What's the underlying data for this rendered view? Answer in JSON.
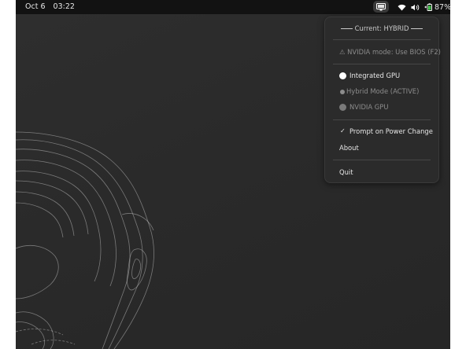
{
  "topbar": {
    "date": "Oct 6",
    "time": "03:22",
    "tray_indicator_icon": "display-gpu-icon",
    "wifi_icon": "wifi-icon",
    "volume_icon": "volume-icon",
    "battery_icon": "battery-charging-icon",
    "battery_level": "87%"
  },
  "menu": {
    "header": "Current: HYBRID",
    "bios_note": "⚠ NVIDIA mode: Use BIOS (F2)",
    "gpu_options": [
      {
        "label": "Integrated GPU",
        "state": "available",
        "color": "#e6e6e6"
      },
      {
        "label": "Hybrid Mode (ACTIVE)",
        "state": "active",
        "color": "#8c8c8c"
      },
      {
        "label": "NVIDIA GPU",
        "state": "disabled",
        "color": "#8c8c8c"
      }
    ],
    "prompt_on_power_change": {
      "label": "Prompt on Power Change",
      "checked": true
    },
    "about": "About",
    "quit": "Quit"
  },
  "colors": {
    "topbar_bg": "#121212",
    "desktop_bg": "#2a2a2a",
    "menu_bg": "#2b2b2b",
    "menu_text": "#e6e6e6",
    "menu_dim_text": "#8c8c8c"
  }
}
